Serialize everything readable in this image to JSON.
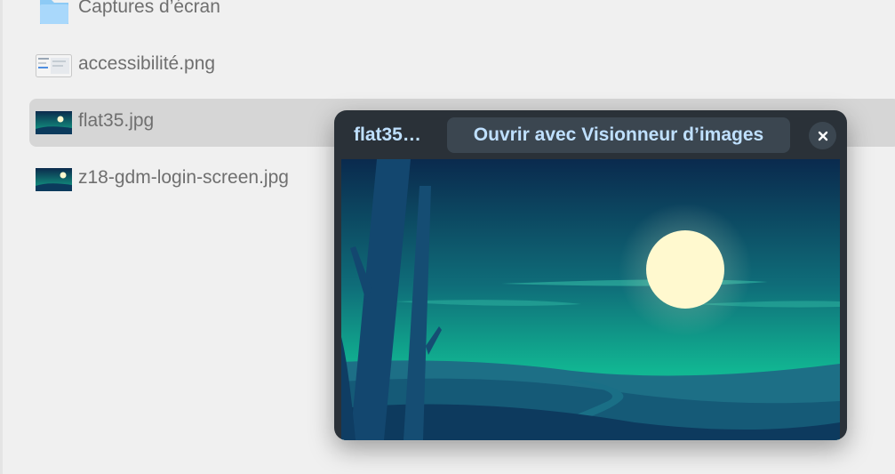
{
  "files": [
    {
      "name": "Captures d’écran",
      "kind": "folder",
      "icon": "folder-icon"
    },
    {
      "name": "accessibilité.png",
      "kind": "image",
      "icon": "screenshot-thumbnail-icon"
    },
    {
      "name": "flat35.jpg",
      "kind": "image",
      "icon": "landscape-thumbnail-icon",
      "selected": true
    },
    {
      "name": "z18-gdm-login-screen.jpg",
      "kind": "image",
      "icon": "landscape-thumbnail-icon"
    }
  ],
  "preview": {
    "title": "flat35…",
    "open_label": "Ouvrir avec Visionneur d’images",
    "close_icon": "close-icon"
  },
  "colors": {
    "selected_row": "#d6d6d6",
    "accent_text": "#bfe0ff",
    "popover_bg": "#2a3138"
  }
}
